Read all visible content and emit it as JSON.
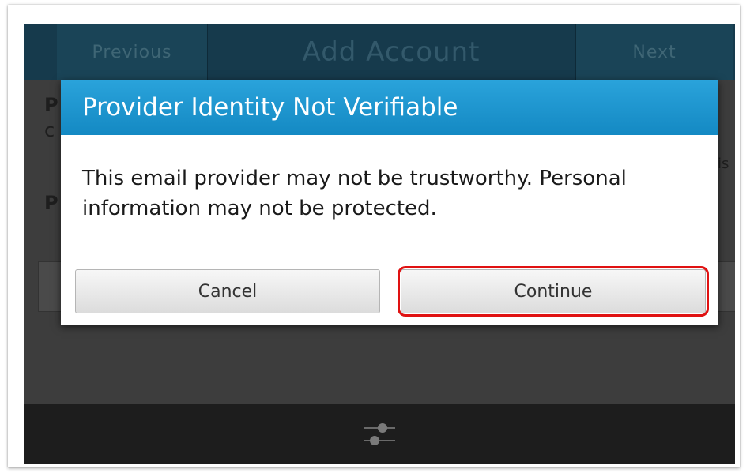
{
  "titlebar": {
    "previous_label": "Previous",
    "title": "Add Account",
    "next_label": "Next"
  },
  "dialog": {
    "title": "Provider Identity Not Verifiable",
    "message": "This email provider may not be trustworthy. Personal information may not be protected.",
    "cancel_label": "Cancel",
    "continue_label": "Continue"
  },
  "background_fragments": {
    "p1": "P",
    "c1": "c",
    "p2": "P",
    "is": "is"
  },
  "colors": {
    "dialog_header": "#1e96cf",
    "highlight": "#e01212",
    "titlebar": "#163a4c"
  },
  "icons": {
    "bottom_bar": "sliders-icon"
  }
}
